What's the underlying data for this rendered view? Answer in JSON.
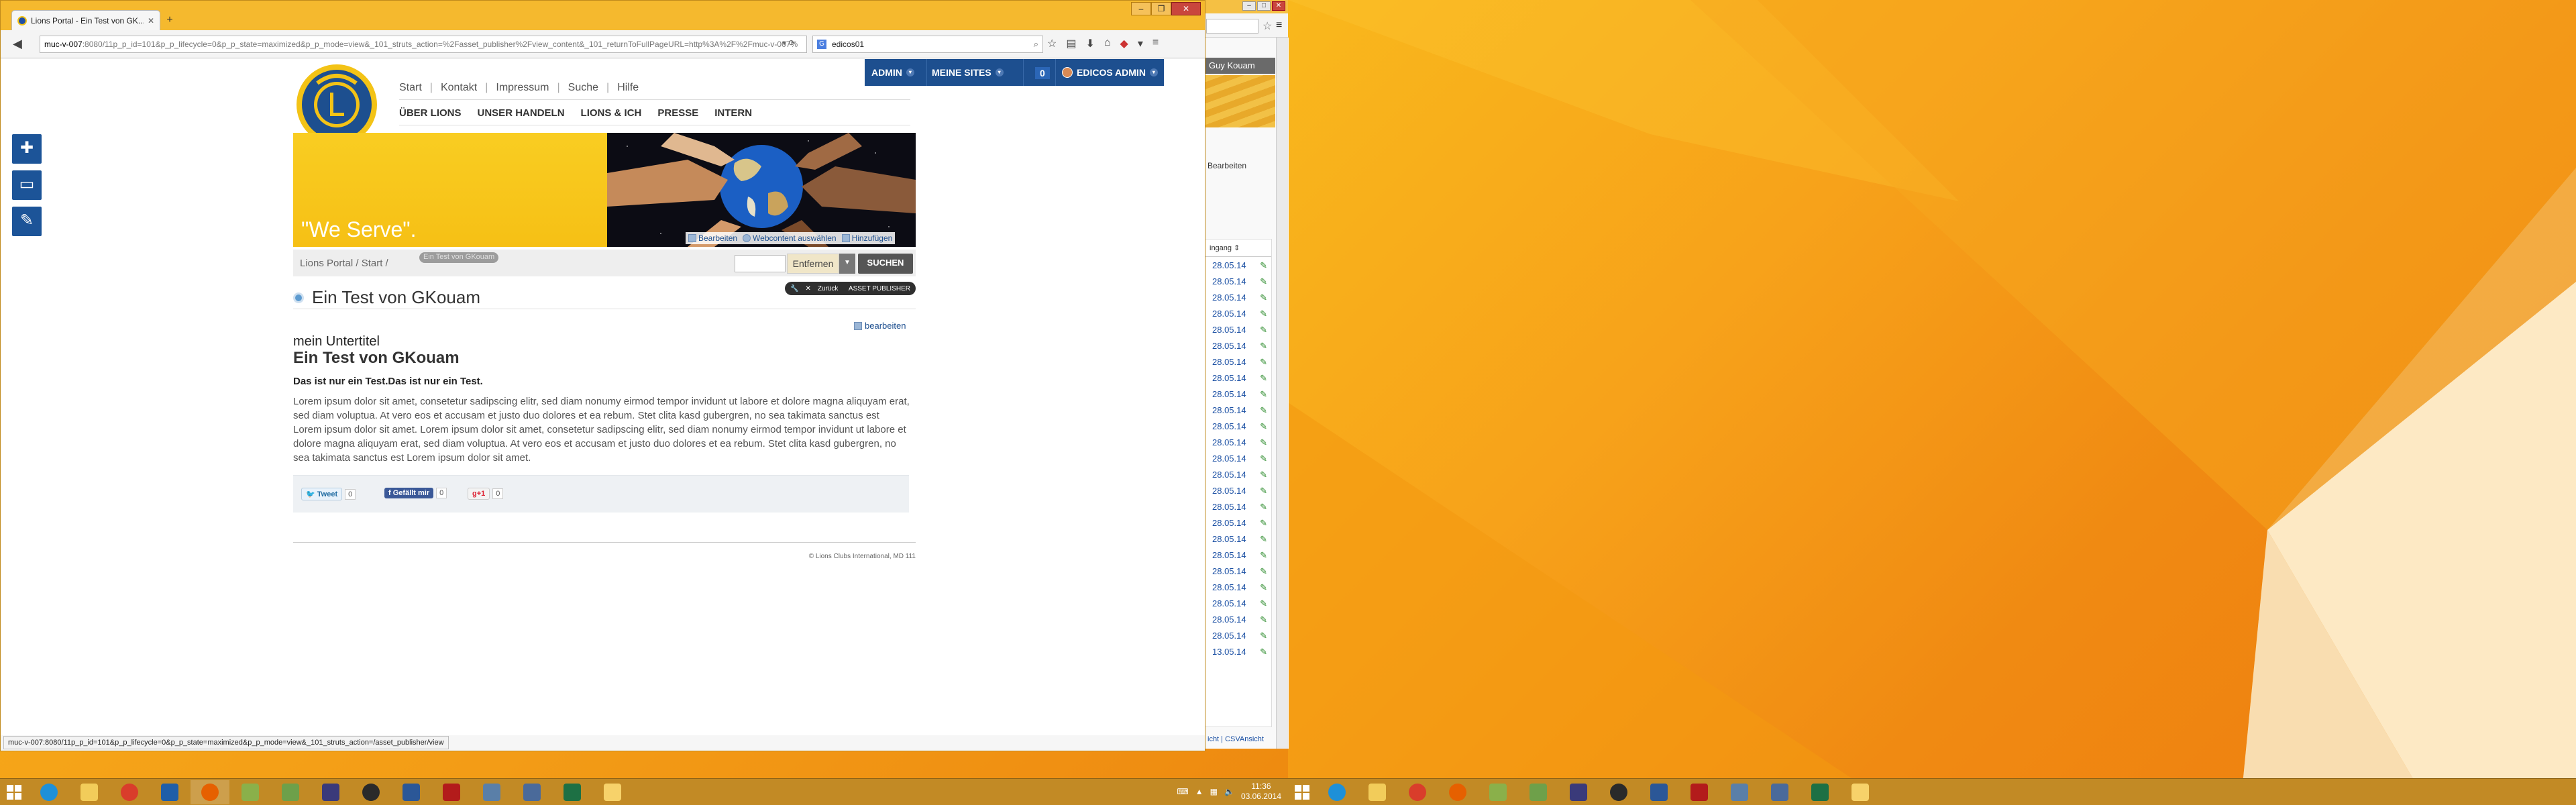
{
  "browser": {
    "tab_title": "Lions Portal - Ein Test von GK...",
    "url_host": "muc-v-007",
    "url_rest": ":8080/11p_p_id=101&p_p_lifecycle=0&p_p_state=maximized&p_p_mode=view&_101_struts_action=%2Fasset_publisher%2Fview_content&_101_returnToFullPageURL=http%3A%2F%2Fmuc-v-007%",
    "search_value": "edicos01",
    "status_url": "muc-v-007:8080/11p_p_id=101&p_p_lifecycle=0&p_p_state=maximized&p_p_mode=view&_101_struts_action=/asset_publisher/view"
  },
  "admin_bar": {
    "admin": "ADMIN",
    "my_sites": "MEINE SITES",
    "count": "0",
    "user": "EDICOS ADMIN"
  },
  "topnav": [
    "Start",
    "Kontakt",
    "Impressum",
    "Suche",
    "Hilfe"
  ],
  "mainnav": [
    "ÜBER LIONS",
    "UNSER HANDELN",
    "LIONS & ICH",
    "PRESSE",
    "INTERN"
  ],
  "banner": {
    "slogan": "\"We Serve\".",
    "edit": "Bearbeiten",
    "select_web": "Webcontent auswählen",
    "add": "Hinzufügen"
  },
  "breadcrumb": {
    "text": "Lions Portal / Start /",
    "tooltip": "Ein Test von GKouam"
  },
  "search": {
    "clear": "Entfernen",
    "button": "SUCHEN"
  },
  "portlet_bar": {
    "back": "Zurück",
    "title": "ASSET PUBLISHER"
  },
  "article": {
    "page_title": "Ein Test von GKouam",
    "edit": "bearbeiten",
    "subtitle": "mein Untertitel",
    "title": "Ein Test von GKouam",
    "lead": "Das ist nur ein Test.Das ist nur ein Test.",
    "body": "Lorem ipsum dolor sit amet, consetetur sadipscing elitr, sed diam nonumy eirmod tempor invidunt ut labore et dolore magna aliquyam erat, sed diam voluptua. At vero eos et accusam et justo duo dolores et ea rebum. Stet clita kasd gubergren, no sea takimata sanctus est Lorem ipsum dolor sit amet. Lorem ipsum dolor sit amet, consetetur sadipscing elitr, sed diam nonumy eirmod tempor invidunt ut labore et dolore magna aliquyam erat, sed diam voluptua. At vero eos et accusam et justo duo dolores et ea rebum. Stet clita kasd gubergren, no sea takimata sanctus est Lorem ipsum dolor sit amet."
  },
  "social": {
    "tweet": "Tweet",
    "tweet_count": "0",
    "like": "Gefällt mir",
    "like_count": "0",
    "gplus": "+1",
    "gplus_count": "0"
  },
  "footer": {
    "copyright": "© Lions Clubs International, MD 111"
  },
  "bg_browser": {
    "user": "Guy Kouam",
    "edit": "Bearbeiten",
    "column": "ingang",
    "dates": [
      "28.05.14",
      "28.05.14",
      "28.05.14",
      "28.05.14",
      "28.05.14",
      "28.05.14",
      "28.05.14",
      "28.05.14",
      "28.05.14",
      "28.05.14",
      "28.05.14",
      "28.05.14",
      "28.05.14",
      "28.05.14",
      "28.05.14",
      "28.05.14",
      "28.05.14",
      "28.05.14",
      "28.05.14",
      "28.05.14",
      "28.05.14",
      "28.05.14",
      "28.05.14",
      "28.05.14",
      "13.05.14"
    ],
    "footer": "icht | CSVAnsicht"
  },
  "tray": {
    "time": "11:36",
    "date": "03.06.2014"
  },
  "colors": {
    "admin_blue": "#1d4f8f",
    "lions_yellow": "#f7c51e",
    "taskbar": "#c28a25"
  }
}
